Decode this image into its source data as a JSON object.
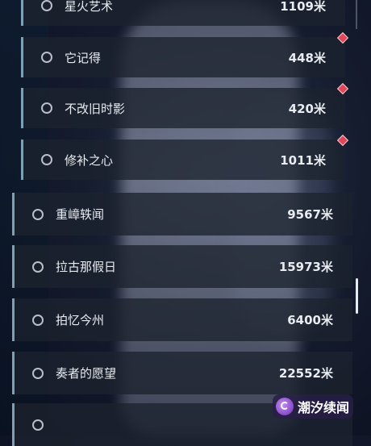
{
  "list": {
    "items": [
      {
        "name": "星火艺术",
        "distance": "1109米",
        "type": "sub",
        "marker": false
      },
      {
        "name": "它记得",
        "distance": "448米",
        "type": "sub",
        "marker": true
      },
      {
        "name": "不改旧时影",
        "distance": "420米",
        "type": "sub",
        "marker": true
      },
      {
        "name": "修补之心",
        "distance": "1011米",
        "type": "sub",
        "marker": true
      },
      {
        "name": "重嶂轶闻",
        "distance": "9567米",
        "type": "main",
        "marker": false
      },
      {
        "name": "拉古那假日",
        "distance": "15973米",
        "type": "main",
        "marker": false
      },
      {
        "name": "拍忆今州",
        "distance": "6400米",
        "type": "main",
        "marker": false
      },
      {
        "name": "奏者的愿望",
        "distance": "22552米",
        "type": "main",
        "marker": false
      }
    ]
  },
  "watermark": {
    "text": "潮汐续闻"
  },
  "colors": {
    "accent_bar": "#7fa0b3",
    "marker": "#e0485a"
  }
}
